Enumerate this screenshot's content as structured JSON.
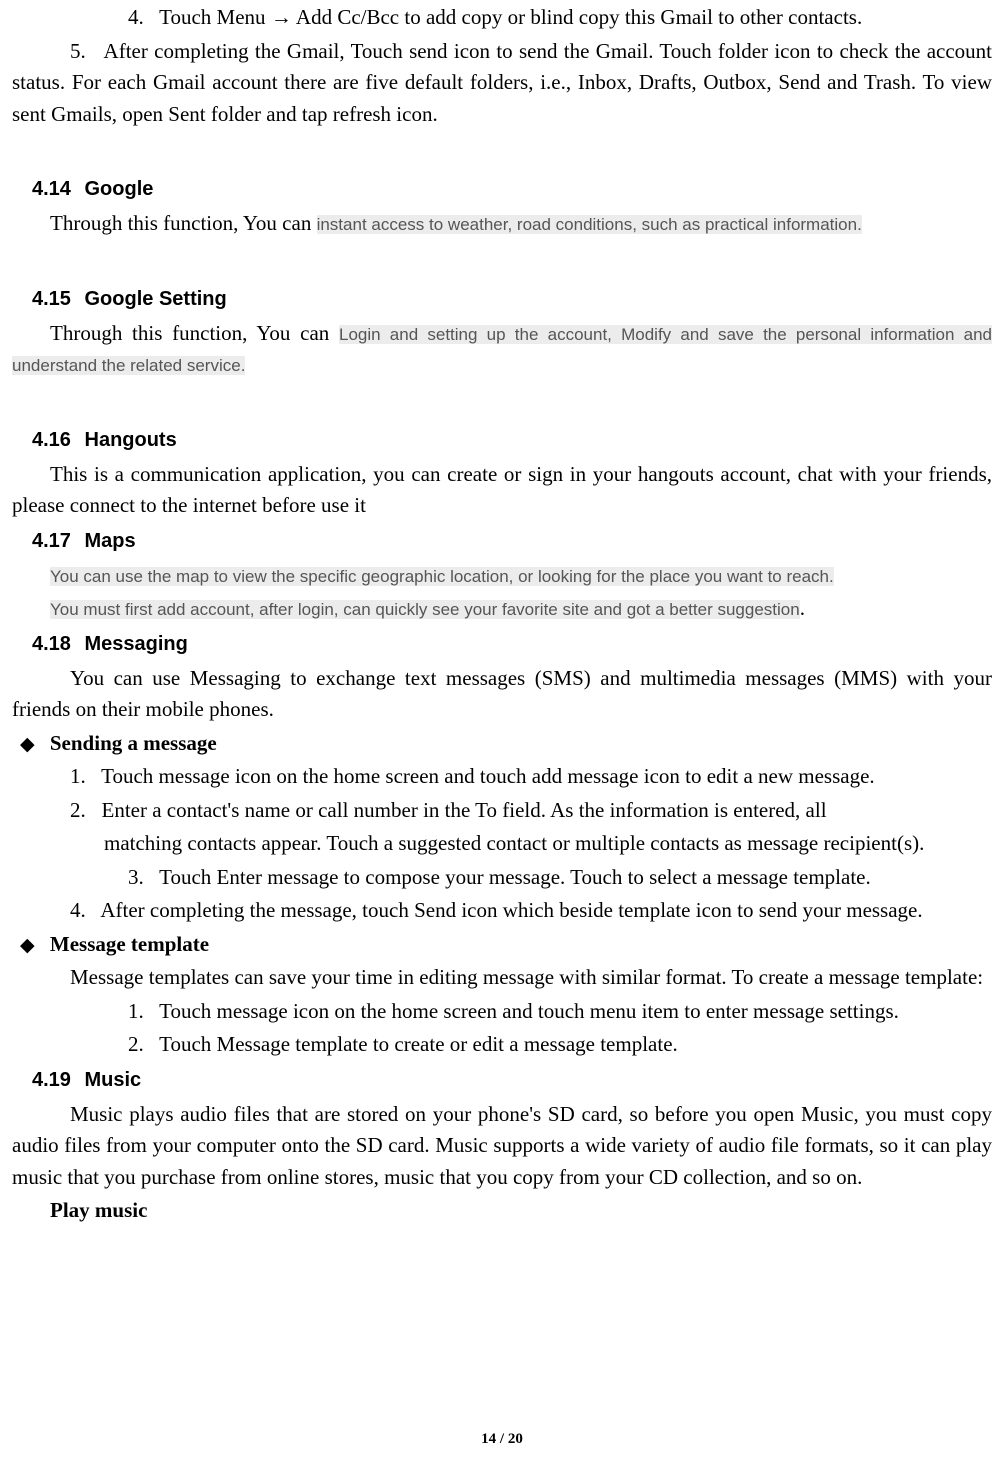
{
  "top": {
    "item4_prefix": "4.",
    "item4_text_a": "Touch Menu ",
    "item4_arrow": "→",
    "item4_text_b": " Add Cc/Bcc to add copy or blind copy this Gmail to other contacts.",
    "item5_prefix": "5.",
    "item5_text": "After completing the Gmail, Touch send icon to send the Gmail. Touch folder icon to check the account status. For each Gmail account there are five default folders, i.e., Inbox, Drafts, Outbox, Send and Trash. To view sent Gmails, open Sent folder and tap refresh icon."
  },
  "s414": {
    "num": "4.14",
    "title": "Google",
    "lead": "Through this function, You can ",
    "hl": "instant access to weather, road conditions, such as practical information."
  },
  "s415": {
    "num": "4.15",
    "title": "Google Setting",
    "lead": "Through this function, You can ",
    "hl": "Login and setting up the account, Modify and save the personal information and understand the related service."
  },
  "s416": {
    "num": "4.16",
    "title": "Hangouts",
    "body": "This is a communication application, you can create or sign in your hangouts account, chat with your friends, please connect to the internet before use it"
  },
  "s417": {
    "num": "4.17",
    "title": "Maps",
    "line1": "You can use the map to view the specific geographic location, or looking for the place you want to reach.",
    "line2": "You must first add account, after login, can quickly see your favorite site and got a better suggestion",
    "period": "."
  },
  "s418": {
    "num": "4.18",
    "title": "Messaging",
    "intro": "You can use Messaging to exchange text messages (SMS) and multimedia messages (MMS) with your friends on their mobile phones.",
    "diamond": "◆",
    "d1_title": "Sending a message",
    "d1_i1_num": "1.",
    "d1_i1": "Touch message icon on the home screen and touch add message icon to edit a new message.",
    "d1_i2_num": "2.",
    "d1_i2_a": "Enter a contact's name or call number in the To field. As the information is entered, all",
    "d1_i2_b": "matching contacts appear. Touch a suggested contact or multiple contacts as message recipient(s).",
    "d1_i3_num": "3.",
    "d1_i3": "Touch Enter message to compose your message. Touch to select a message template.",
    "d1_i4_num": "4.",
    "d1_i4": "After completing the message, touch Send icon which beside template icon to send your message.",
    "d2_title": "Message template",
    "d2_intro": "Message templates can save your time in editing message with similar format. To create a message template:",
    "d2_i1_num": "1.",
    "d2_i1": "Touch message icon on the home screen and touch menu item to enter message settings.",
    "d2_i2_num": "2.",
    "d2_i2": "Touch Message template to create or edit a message template."
  },
  "s419": {
    "num": "4.19",
    "title": "Music",
    "body": "Music plays audio files that are stored on your phone's SD card, so before you open Music, you must copy audio files from your computer onto the SD card. Music supports a wide variety of audio file formats, so it can play music that you purchase from online stores, music that you copy from your CD collection, and so on.",
    "sub": "Play music"
  },
  "footer": "14 / 20"
}
